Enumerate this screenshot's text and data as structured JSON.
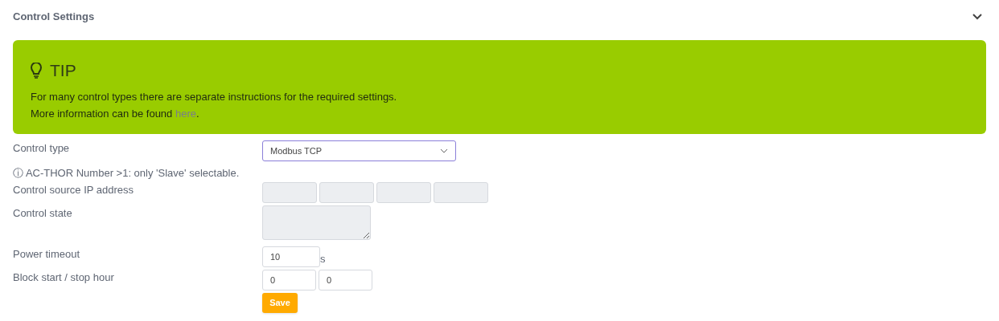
{
  "section": {
    "title": "Control Settings",
    "expanded": true
  },
  "tip": {
    "title": "TIP",
    "line1": "For many control types there are separate instructions for the required settings.",
    "line2_before": "More information can be found ",
    "link": "here",
    "line2_after": "."
  },
  "control_type": {
    "label": "Control type",
    "value": "Modbus TCP"
  },
  "note": "ⓘ AC-THOR Number >1: only 'Slave' selectable.",
  "ip": {
    "label": "Control source IP address",
    "octets": [
      {
        "disabled": true
      },
      {
        "disabled": true
      },
      {
        "disabled": true
      },
      {
        "disabled": true
      }
    ]
  },
  "state": {
    "label": "Control state",
    "disabled": true
  },
  "timeout": {
    "label": "Power timeout",
    "value": "10",
    "unit": "s"
  },
  "block": {
    "label": "Block start / stop hour",
    "start": "0",
    "stop": "0"
  },
  "save": "Save"
}
